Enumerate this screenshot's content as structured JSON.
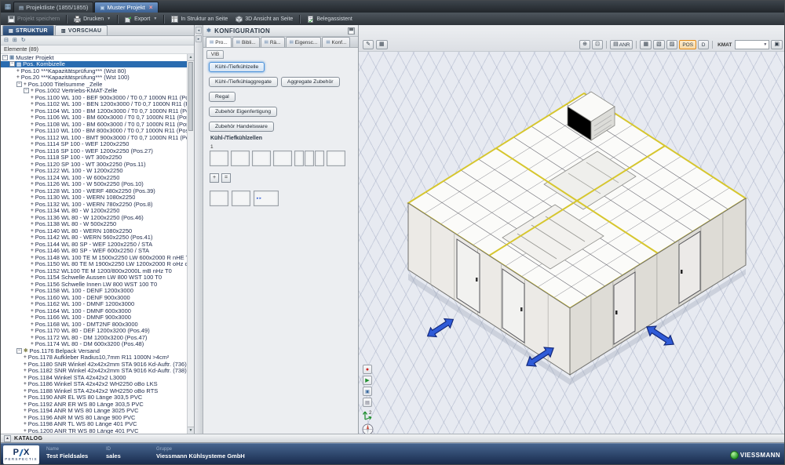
{
  "window_tabs": {
    "items": [
      {
        "label": "Projektliste (1855/1855)"
      },
      {
        "label": "Muster Projekt"
      }
    ]
  },
  "toolbar": {
    "buttons": [
      {
        "label": "Projekt speichern"
      },
      {
        "label": "Drucken"
      },
      {
        "label": "Export"
      },
      {
        "label": "In Struktur an Seite"
      },
      {
        "label": "3D Ansicht an Seite"
      },
      {
        "label": "Belegassistent"
      }
    ]
  },
  "sidebar": {
    "tabs": {
      "structure": "STRUKTUR",
      "preview": "VORSCHAU"
    },
    "elements_header": "Elemente (89)",
    "tree": {
      "items": [
        {
          "label": "Muster Projekt",
          "level": 0,
          "icon": "project",
          "expand": true
        },
        {
          "label": "Pos. Kombizelle",
          "level": 1,
          "icon": "cell",
          "expand": true,
          "selected": true
        },
        {
          "label": "Pos.10 ***Kapazitätsprüfung*** (Wst 80)",
          "level": 2,
          "icon": "plus"
        },
        {
          "label": "Pos.20 ***Kapazitätsprüfung*** (Wst 100)",
          "level": 2,
          "icon": "plus"
        },
        {
          "label": "Pos.1000 Titelsumme _Zelle",
          "level": 2,
          "icon": "plus",
          "expand": true
        },
        {
          "label": "Pos.1002 Vertriebs-KMAT-Zelle",
          "level": 3,
          "icon": "plus",
          "expand": true
        },
        {
          "label": "Pos.1100 WL 100 - BEF 900x3000 / T0 0,7 1000N R11 (Pos...",
          "level": 4,
          "icon": "plus"
        },
        {
          "label": "Pos.1102 WL 100 - BEN 1200x3000 / T0 0,7 1000N R11 (P...",
          "level": 4,
          "icon": "plus"
        },
        {
          "label": "Pos.1104 WL 100 - BM 1200x3000 / T0 0,7 1000N R11 (Po...",
          "level": 4,
          "icon": "plus"
        },
        {
          "label": "Pos.1106 WL 100 - BM 600x3000 / T0 0,7 1000N R11 (Pos.5)",
          "level": 4,
          "icon": "plus"
        },
        {
          "label": "Pos.1108 WL 100 - BM 600x3000 / T0 0,7 1000N R11 (Pos.5)",
          "level": 4,
          "icon": "plus"
        },
        {
          "label": "Pos.1110 WL 100 - BM 800x3000 / T0 0,7 1000N R11 (Pos.5)",
          "level": 4,
          "icon": "plus"
        },
        {
          "label": "Pos.1112 WL 100 - BMT 900x3000 / T0 0,7 1000N R11 (Pos.5)",
          "level": 4,
          "icon": "plus"
        },
        {
          "label": "Pos.1114 SP 100 - WEF 1200x2250",
          "level": 4,
          "icon": "plus"
        },
        {
          "label": "Pos.1116 SP 100 - WEF 1200x2250 (Pos.27)",
          "level": 4,
          "icon": "plus"
        },
        {
          "label": "Pos.1118 SP 100 - WT 300x2250",
          "level": 4,
          "icon": "plus"
        },
        {
          "label": "Pos.1120 SP 100 - WT 300x2250 (Pos.11)",
          "level": 4,
          "icon": "plus"
        },
        {
          "label": "Pos.1122 WL 100 - W 1200x2250",
          "level": 4,
          "icon": "plus"
        },
        {
          "label": "Pos.1124 WL 100 - W 600x2250",
          "level": 4,
          "icon": "plus"
        },
        {
          "label": "Pos.1126 WL 100 - W 500x2250 (Pos.10)",
          "level": 4,
          "icon": "plus"
        },
        {
          "label": "Pos.1128 WL 100 - WERF 480x2250 (Pos.39)",
          "level": 4,
          "icon": "plus"
        },
        {
          "label": "Pos.1130 WL 100 - WERN 1080x2250",
          "level": 4,
          "icon": "plus"
        },
        {
          "label": "Pos.1132 WL 100 - WERN 780x2250 (Pos.8)",
          "level": 4,
          "icon": "plus"
        },
        {
          "label": "Pos.1134 WL 80 - W 1200x2250",
          "level": 4,
          "icon": "plus"
        },
        {
          "label": "Pos.1136 WL 80 - W 1200x2250 (Pos.46)",
          "level": 4,
          "icon": "plus"
        },
        {
          "label": "Pos.1138 WL 80 - W 500x2250",
          "level": 4,
          "icon": "plus"
        },
        {
          "label": "Pos.1140 WL 80 - WERN 1080x2250",
          "level": 4,
          "icon": "plus"
        },
        {
          "label": "Pos.1142 WL 80 - WERN 560x2250 (Pos.41)",
          "level": 4,
          "icon": "plus"
        },
        {
          "label": "Pos.1144 WL 80 SP - WEF 1200x2250 / STA",
          "level": 4,
          "icon": "plus"
        },
        {
          "label": "Pos.1146 WL 80 SP - WEF 600x2250 / STA",
          "level": 4,
          "icon": "plus"
        },
        {
          "label": "Pos.1148 WL 100 TE M 1500x2250 LW 600x2000 R nHE T...",
          "level": 4,
          "icon": "plus"
        },
        {
          "label": "Pos.1150 WL 80 TE M 1900x2250 LW 1200x2000 R oHz oB...",
          "level": 4,
          "icon": "plus"
        },
        {
          "label": "Pos.1152 WL100 TE M 1200/800x2000L mB nHz T0",
          "level": 4,
          "icon": "plus"
        },
        {
          "label": "Pos.1154 Schwelle Aussen LW 800 WST 100 T0",
          "level": 4,
          "icon": "plus"
        },
        {
          "label": "Pos.1156 Schwelle Innen LW 800 WST 100 T0",
          "level": 4,
          "icon": "plus"
        },
        {
          "label": "Pos.1158 WL 100 - DENF 1200x3000",
          "level": 4,
          "icon": "plus"
        },
        {
          "label": "Pos.1160 WL 100 - DENF 900x3000",
          "level": 4,
          "icon": "plus"
        },
        {
          "label": "Pos.1162 WL 100 - DMNF 1200x3000",
          "level": 4,
          "icon": "plus"
        },
        {
          "label": "Pos.1164 WL 100 - DMNF 600x3000",
          "level": 4,
          "icon": "plus"
        },
        {
          "label": "Pos.1166 WL 100 - DMNF 900x3000",
          "level": 4,
          "icon": "plus"
        },
        {
          "label": "Pos.1168 WL 100 - DMT2NF 800x3000",
          "level": 4,
          "icon": "plus"
        },
        {
          "label": "Pos.1170 WL 80 - DEF 1200x3200 (Pos.49)",
          "level": 4,
          "icon": "plus"
        },
        {
          "label": "Pos.1172 WL 80 - DM 1200x3200 (Pos.47)",
          "level": 4,
          "icon": "plus"
        },
        {
          "label": "Pos.1174 WL 80 - DM 600x3200 (Pos.48)",
          "level": 4,
          "icon": "plus"
        },
        {
          "label": "Pos.1176 Belpack Versand",
          "level": 2,
          "icon": "gear",
          "expand": true
        },
        {
          "label": "Pos.1178 Aufkleber Radius10,7mm R11 1000N >4cm²",
          "level": 3,
          "icon": "plus"
        },
        {
          "label": "Pos.1180 SNR Winkel 42x42x2mm STA 9016 Kd-Auftr. (736)",
          "level": 3,
          "icon": "plus"
        },
        {
          "label": "Pos.1182 SNR Winkel 42x42x2mm STA 9016 Kd-Auftr. (738)",
          "level": 3,
          "icon": "plus"
        },
        {
          "label": "Pos.1184 Winkel STA 42x42x2 L3000",
          "level": 3,
          "icon": "plus"
        },
        {
          "label": "Pos.1186 Winkel STA 42x42x2 WH2250 oBo LKS",
          "level": 3,
          "icon": "plus"
        },
        {
          "label": "Pos.1188 Winkel STA 42x42x2 WH2250 oBo RTS",
          "level": 3,
          "icon": "plus"
        },
        {
          "label": "Pos.1190 ANR EL WS 80 Länge 303,5 PVC",
          "level": 3,
          "icon": "plus"
        },
        {
          "label": "Pos.1192 ANR ER WS 80 Länge 303,5 PVC",
          "level": 3,
          "icon": "plus"
        },
        {
          "label": "Pos.1194 ANR M WS 80 Länge 3025 PVC",
          "level": 3,
          "icon": "plus"
        },
        {
          "label": "Pos.1196 ANR M WS 80 Länge 900 PVC",
          "level": 3,
          "icon": "plus"
        },
        {
          "label": "Pos.1198 ANR TL WS 80 Länge 401 PVC",
          "level": 3,
          "icon": "plus"
        },
        {
          "label": "Pos.1200 ANR TR WS 80 Länge 401 PVC",
          "level": 3,
          "icon": "plus"
        }
      ]
    }
  },
  "config": {
    "title": "KONFIGURATION",
    "tabs": [
      "Pro...",
      "Bibli...",
      "Rä...",
      "Eigensc...",
      "Konf..."
    ],
    "side_tab": "VIB",
    "buttons": [
      "Kühl-/Tiefkühlzelle",
      "Kühl-/Tiefkühlaggregate",
      "Aggregate Zubehör",
      "Regal",
      "Zubehör Eigenfertigung",
      "Zubehör Handelsware"
    ],
    "section_label": "Kühl-/Tiefkühlzellen",
    "slot_index": "1",
    "mini_buttons": [
      "+",
      "="
    ]
  },
  "viewport": {
    "toolbar": {
      "anr": "ANR",
      "pos": "POS",
      "d": "D",
      "kmat": "KMAT"
    },
    "axis_label": "2"
  },
  "katalog": {
    "label": "KATALOG"
  },
  "footer": {
    "logo_main_left": "P",
    "logo_main_right": "X",
    "logo_sub": "PERSPECTIX",
    "fields": [
      {
        "label": "Name",
        "value": "Test Fieldsales"
      },
      {
        "label": "ID",
        "value": "sales"
      },
      {
        "label": "Gruppe",
        "value": "Viessmann Kühlsysteme GmbH"
      }
    ],
    "brand": "VIESSMANN"
  },
  "colors": {
    "selection_blue": "#2a6cb0",
    "accent_yellow": "#d6c62e",
    "arrow_blue": "#2f5bd8",
    "viewport_grid": "#9ba5be",
    "footer_blue": "#2c4a78"
  }
}
